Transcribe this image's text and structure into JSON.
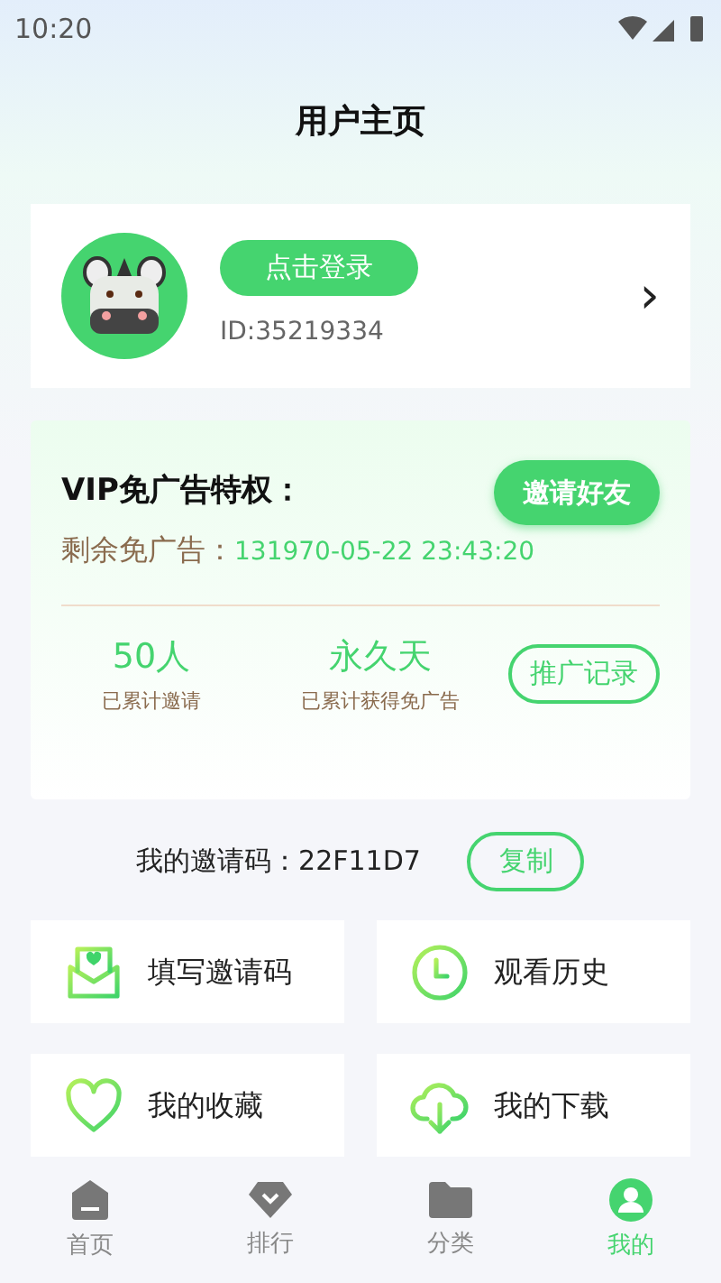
{
  "status_bar": {
    "time": "10:20"
  },
  "title": "用户主页",
  "profile": {
    "login_button": "点击登录",
    "user_id": "ID:35219334",
    "chevron": "›"
  },
  "vip": {
    "title": "VIP免广告特权：",
    "invite_button": "邀请好友",
    "remaining_label": "剩余免广告：",
    "remaining_value": "131970-05-22 23:43:20",
    "stats": [
      {
        "value": "50人",
        "label": "已累计邀请"
      },
      {
        "value": "永久天",
        "label": "已累计获得免广告"
      }
    ],
    "records_button": "推广记录"
  },
  "invite_code": {
    "label": "我的邀请码：22F11D7",
    "copy_button": "复制"
  },
  "menu": [
    {
      "kind": "envelope",
      "label": "填写邀请码"
    },
    {
      "kind": "clock",
      "label": "观看历史"
    },
    {
      "kind": "heart",
      "label": "我的收藏"
    },
    {
      "kind": "download",
      "label": "我的下载"
    }
  ],
  "tabs": [
    {
      "kind": "home",
      "label": "首页",
      "selected": false
    },
    {
      "kind": "rank",
      "label": "排行",
      "selected": false
    },
    {
      "kind": "folder",
      "label": "分类",
      "selected": false
    },
    {
      "kind": "user",
      "label": "我的",
      "selected": true
    }
  ]
}
